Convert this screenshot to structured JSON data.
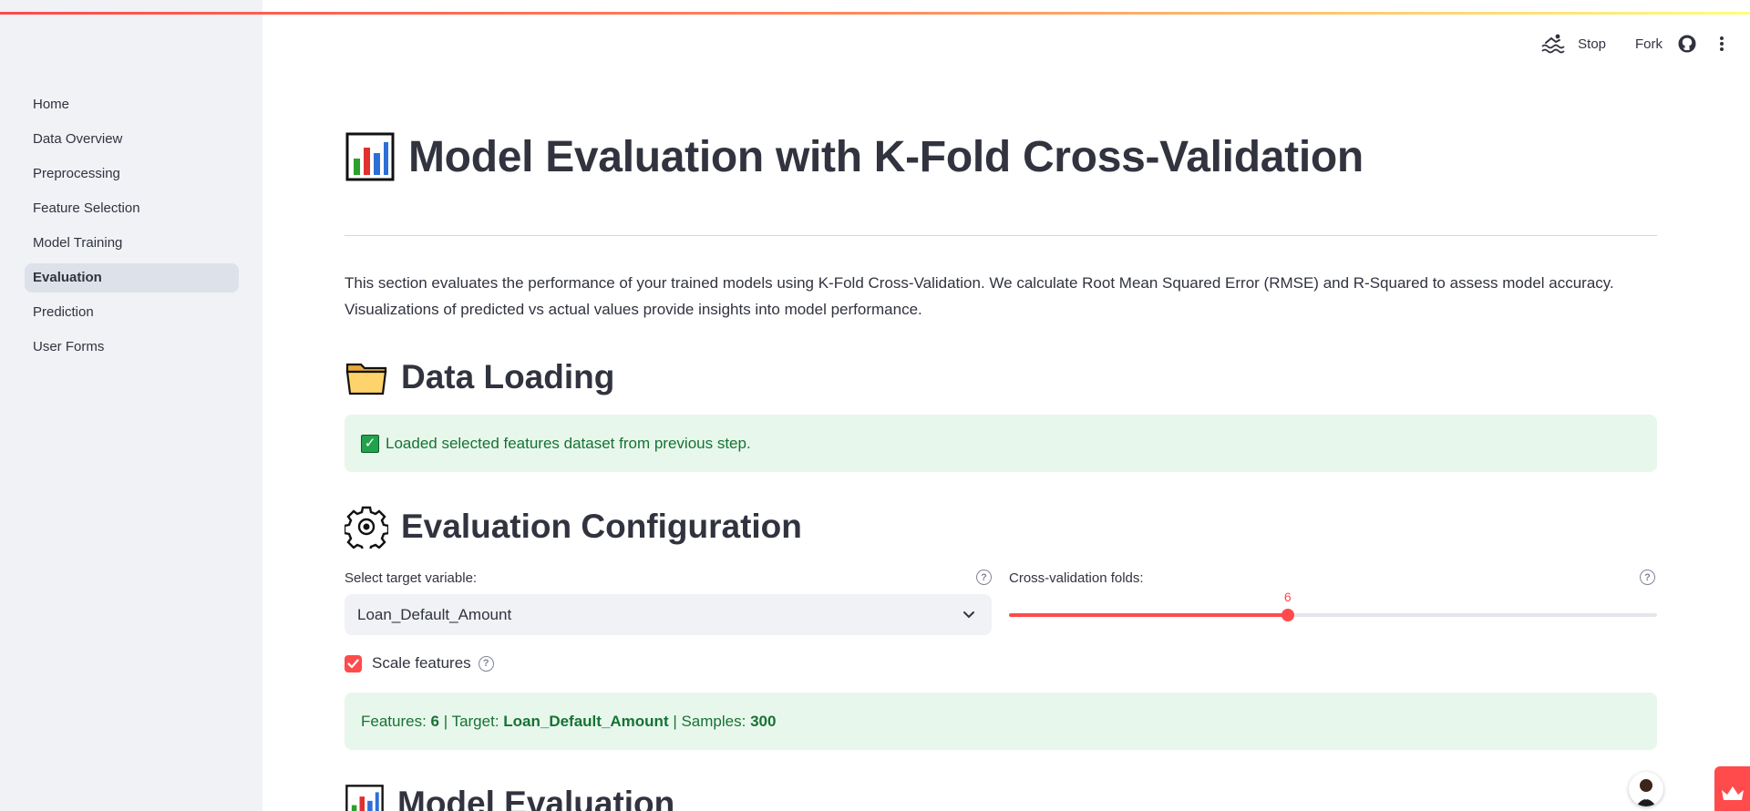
{
  "sidebar": {
    "items": [
      {
        "label": "Home",
        "active": false
      },
      {
        "label": "Data Overview",
        "active": false
      },
      {
        "label": "Preprocessing",
        "active": false
      },
      {
        "label": "Feature Selection",
        "active": false
      },
      {
        "label": "Model Training",
        "active": false
      },
      {
        "label": "Evaluation",
        "active": true
      },
      {
        "label": "Prediction",
        "active": false
      },
      {
        "label": "User Forms",
        "active": false
      }
    ]
  },
  "header": {
    "running_icon": "swimmer-icon",
    "stop_label": "Stop",
    "fork_label": "Fork",
    "github_icon": "github-icon",
    "menu_icon": "more-vert-icon"
  },
  "page": {
    "title": "Model Evaluation with K-Fold Cross-Validation",
    "title_icon": "bar-chart-icon",
    "intro": "This section evaluates the performance of your trained models using K-Fold Cross-Validation. We calculate Root Mean Squared Error (RMSE) and R-Squared to assess model accuracy. Visualizations of predicted vs actual values provide insights into model performance.",
    "data_loading": {
      "heading": "Data Loading",
      "icon": "folder-icon",
      "success_message": "Loaded selected features dataset from previous step."
    },
    "config": {
      "heading": "Evaluation Configuration",
      "icon": "gear-icon",
      "target_label": "Select target variable:",
      "target_value": "Loan_Default_Amount",
      "folds_label": "Cross-validation folds:",
      "folds_value": "6",
      "folds_fraction": 0.43,
      "scale_label": "Scale features",
      "scale_checked": true,
      "summary": {
        "features_label": "Features: ",
        "features_value": "6",
        "target_label": " | Target: ",
        "target_value": "Loan_Default_Amount",
        "samples_label": " | Samples: ",
        "samples_value": "300"
      }
    },
    "model_eval": {
      "heading": "Model Evaluation",
      "icon": "bar-chart-icon"
    }
  },
  "colors": {
    "accent": "#ff4b4b",
    "success_bg": "#e8f7ec",
    "success_text": "#177233",
    "sidebar_bg": "#f0f2f6"
  }
}
